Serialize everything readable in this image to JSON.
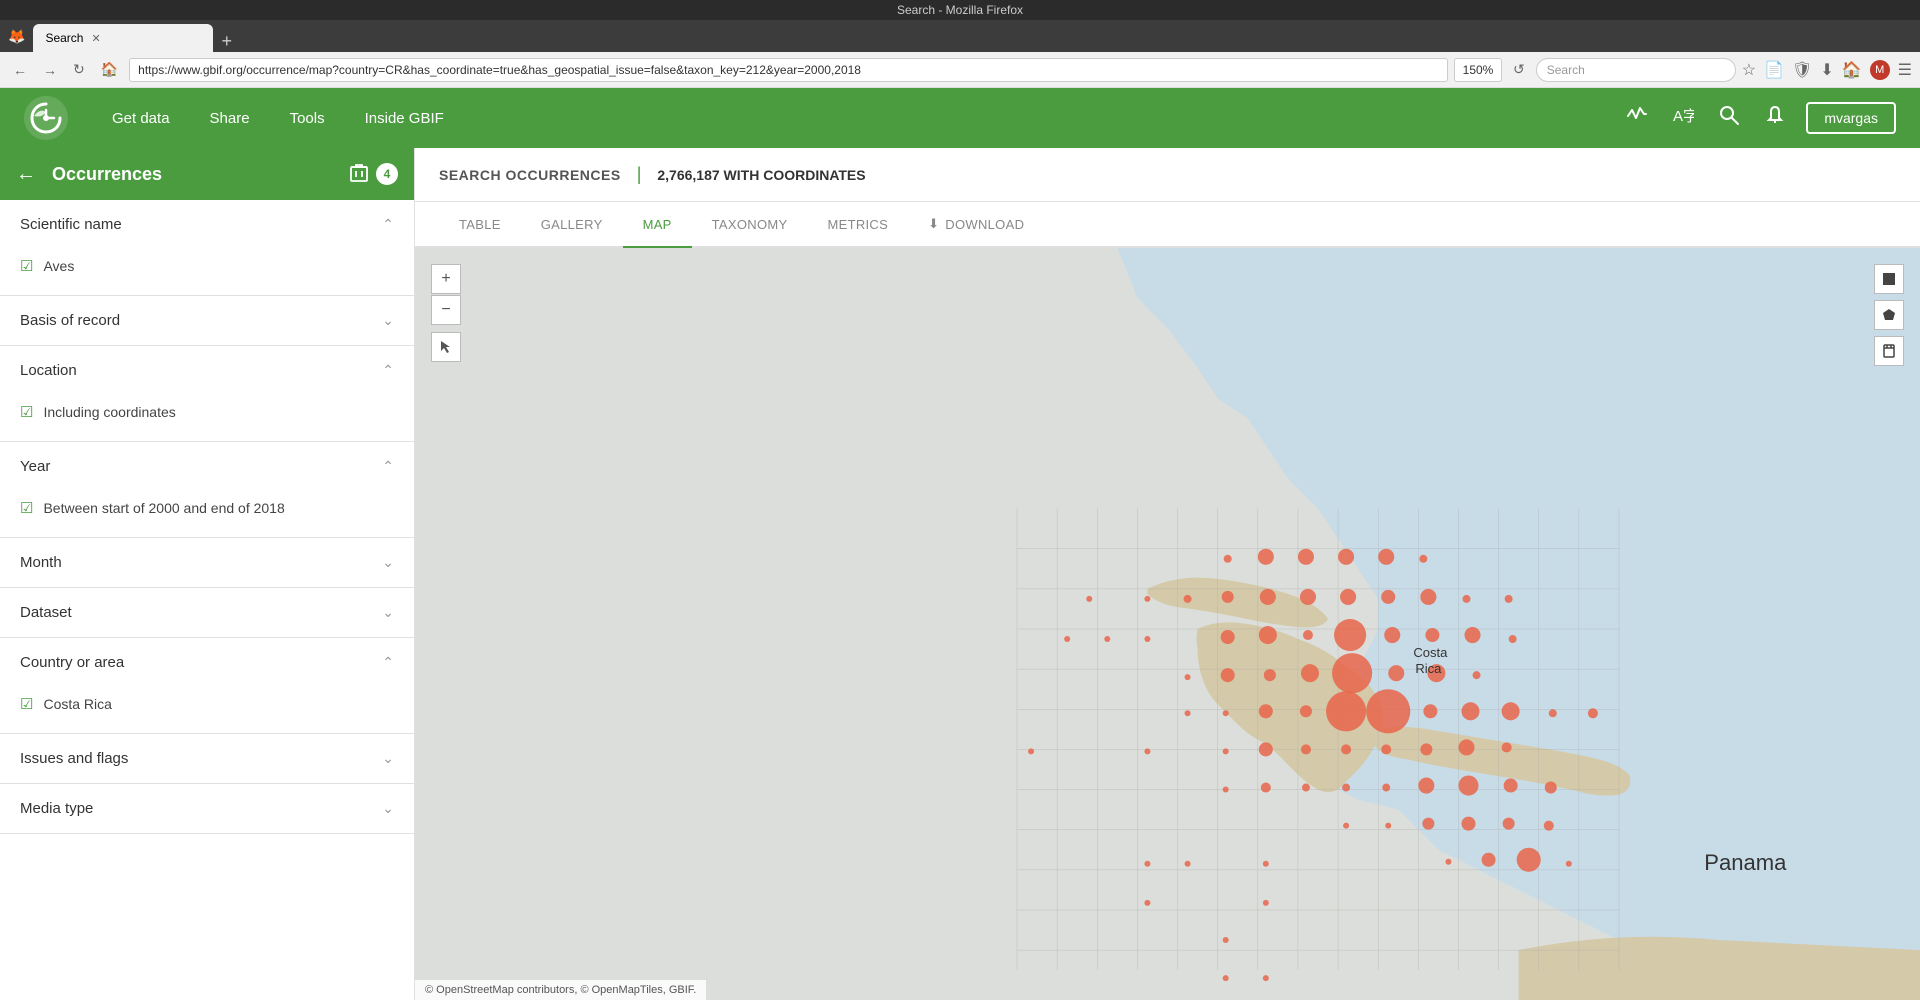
{
  "browser": {
    "title": "Search - Mozilla Firefox",
    "tab_label": "Search",
    "url": "https://www.gbif.org/occurrence/map?country=CR&has_coordinate=true&has_geospatial_issue=false&taxon_key=212&year=2000,2018",
    "zoom": "150%",
    "search_placeholder": "Search"
  },
  "nav": {
    "links": [
      "Get data",
      "Share",
      "Tools",
      "Inside GBIF"
    ],
    "user": "mvargas"
  },
  "sidebar": {
    "title": "Occurrences",
    "badge": "4",
    "filters": [
      {
        "id": "scientific-name",
        "label": "Scientific name",
        "expanded": true,
        "items": [
          "Aves"
        ]
      },
      {
        "id": "basis-of-record",
        "label": "Basis of record",
        "expanded": false,
        "items": []
      },
      {
        "id": "location",
        "label": "Location",
        "expanded": true,
        "items": [
          "Including coordinates"
        ]
      },
      {
        "id": "year",
        "label": "Year",
        "expanded": true,
        "items": [
          "Between start of 2000 and end of 2018"
        ]
      },
      {
        "id": "month",
        "label": "Month",
        "expanded": false,
        "items": []
      },
      {
        "id": "dataset",
        "label": "Dataset",
        "expanded": false,
        "items": []
      },
      {
        "id": "country-or-area",
        "label": "Country or area",
        "expanded": true,
        "items": [
          "Costa Rica"
        ]
      },
      {
        "id": "issues-and-flags",
        "label": "Issues and flags",
        "expanded": false,
        "items": []
      },
      {
        "id": "media-type",
        "label": "Media type",
        "expanded": false,
        "items": []
      }
    ]
  },
  "content": {
    "header_title": "SEARCH OCCURRENCES",
    "count": "2,766,187 WITH COORDINATES",
    "tabs": [
      "TABLE",
      "GALLERY",
      "MAP",
      "TAXONOMY",
      "METRICS",
      "DOWNLOAD"
    ],
    "active_tab": "MAP",
    "download_icon": "⬇"
  },
  "map": {
    "attribution": "© OpenStreetMap contributors, © OpenMapTiles, GBIF.",
    "panama_label": "Panama",
    "costa_rica_label": "Costa Rica",
    "controls": {
      "zoom_in": "+",
      "zoom_out": "−",
      "select_tool": "⊹"
    }
  }
}
